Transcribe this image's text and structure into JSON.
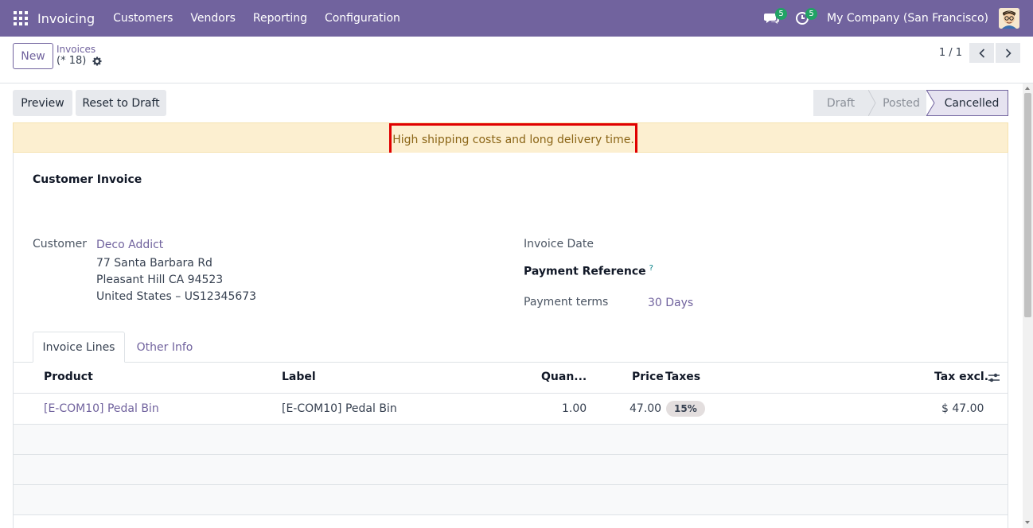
{
  "navbar": {
    "app_name": "Invoicing",
    "menu": [
      "Customers",
      "Vendors",
      "Reporting",
      "Configuration"
    ],
    "messages_count": "5",
    "activities_count": "5",
    "company": "My Company (San Francisco)",
    "bg_color": "#71639e"
  },
  "control_panel": {
    "new_label": "New",
    "breadcrumb_parent": "Invoices",
    "breadcrumb_current": "(* 18)",
    "pager": "1 / 1"
  },
  "statusbar": {
    "preview_label": "Preview",
    "reset_label": "Reset to Draft",
    "states": [
      "Draft",
      "Posted",
      "Cancelled"
    ],
    "active_state": "Cancelled"
  },
  "alert": {
    "message": "High shipping costs and long delivery time."
  },
  "form": {
    "title": "Customer Invoice",
    "customer_label": "Customer",
    "customer_name": "Deco Addict",
    "address_line1": "77 Santa Barbara Rd",
    "address_line2": "Pleasant Hill CA 94523",
    "address_line3": "United States – US12345673",
    "invoice_date_label": "Invoice Date",
    "payment_ref_label": "Payment Reference",
    "help_mark": "?",
    "payment_terms_label": "Payment terms",
    "payment_terms_value": "30 Days"
  },
  "tabs": [
    "Invoice Lines",
    "Other Info"
  ],
  "table": {
    "headers": {
      "product": "Product",
      "label": "Label",
      "quantity": "Quan...",
      "price": "Price",
      "taxes": "Taxes",
      "tax_excl": "Tax excl."
    },
    "rows": [
      {
        "product": "[E-COM10] Pedal Bin",
        "label": "[E-COM10] Pedal Bin",
        "quantity": "1.00",
        "price": "47.00",
        "taxes": "15%",
        "tax_excl": "$ 47.00"
      }
    ]
  }
}
